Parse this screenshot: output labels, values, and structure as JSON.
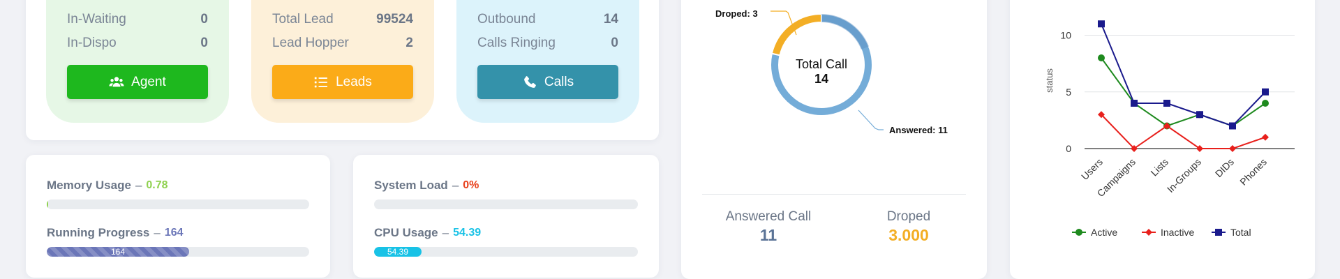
{
  "stats": {
    "agent_box": {
      "rows": [
        {
          "label": "In-Waiting",
          "value": "0"
        },
        {
          "label": "In-Dispo",
          "value": "0"
        }
      ],
      "button_label": "Agent",
      "button_icon": "users-icon"
    },
    "lead_box": {
      "rows": [
        {
          "label": "Total Lead",
          "value": "99524"
        },
        {
          "label": "Lead Hopper",
          "value": "2"
        }
      ],
      "button_label": "Leads",
      "button_icon": "list-icon"
    },
    "call_box": {
      "rows": [
        {
          "label": "Outbound",
          "value": "14"
        },
        {
          "label": "Calls Ringing",
          "value": "0"
        }
      ],
      "button_label": "Calls",
      "button_icon": "phone-icon"
    }
  },
  "usage": {
    "memory": {
      "label": "Memory Usage",
      "sep": "–",
      "value": "0.78",
      "progress_fraction": 0.002
    },
    "running": {
      "label": "Running Progress",
      "sep": "–",
      "value": "164",
      "bar_text": "164",
      "progress_fraction": 0.54
    },
    "system_load": {
      "label": "System Load",
      "sep": "–",
      "value": "0%",
      "progress_fraction": 0
    },
    "cpu": {
      "label": "CPU Usage",
      "sep": "–",
      "value": "54.39",
      "bar_text": "54.39",
      "progress_fraction": 0.18
    }
  },
  "donut": {
    "center_title": "Total Call",
    "center_value": "14",
    "slices": [
      {
        "label": "Droped: 3",
        "value": 3,
        "color": "#f3ae25"
      },
      {
        "label": "Answered: 11",
        "value": 11,
        "color": "#74acd8"
      }
    ],
    "answered": {
      "label": "Answered Call",
      "value": "11",
      "color": "#5a7396"
    },
    "droped": {
      "label": "Droped",
      "value": "3.000",
      "color": "#f3ae25"
    }
  },
  "chart_data": {
    "type": "line",
    "categories": [
      "Users",
      "Campaigns",
      "Lists",
      "In-Groups",
      "DIDs",
      "Phones"
    ],
    "ylabel": "status",
    "ylim": [
      0,
      12
    ],
    "yticks": [
      0,
      5,
      10
    ],
    "grid": true,
    "legend_position": "bottom",
    "series": [
      {
        "name": "Active",
        "values": [
          8,
          4,
          2,
          3,
          2,
          4
        ],
        "color": "#1e8a1e",
        "marker": "circle"
      },
      {
        "name": "Inactive",
        "values": [
          3,
          0,
          2,
          0,
          0,
          1
        ],
        "color": "#e8201c",
        "marker": "diamond"
      },
      {
        "name": "Total",
        "values": [
          11,
          4,
          4,
          3,
          2,
          5
        ],
        "color": "#1a1a8c",
        "marker": "square"
      }
    ]
  }
}
